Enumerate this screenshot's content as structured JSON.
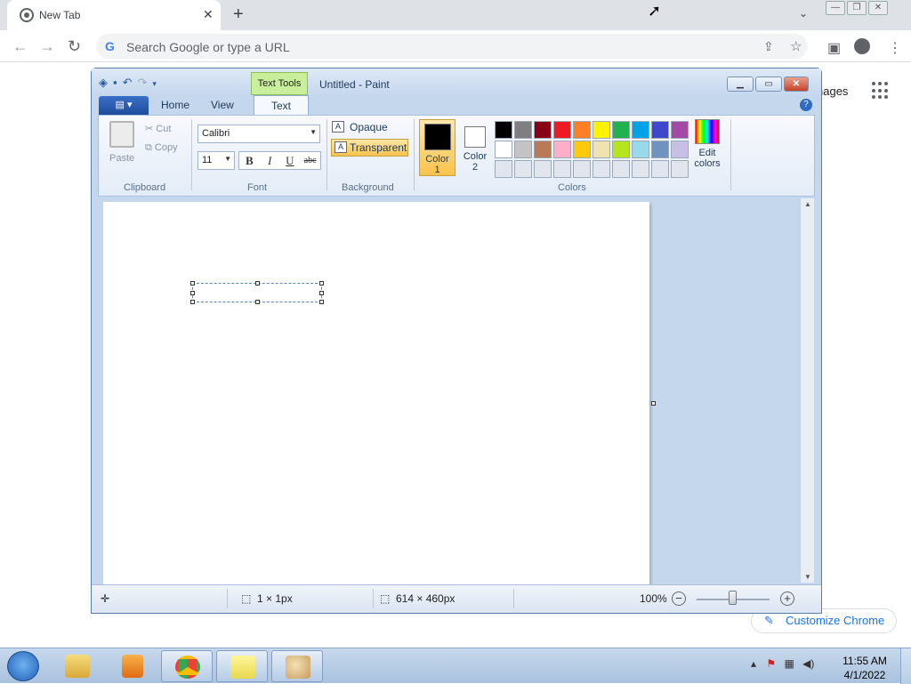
{
  "browser": {
    "tab_title": "New Tab",
    "tab_close": "✕",
    "new_tab": "+",
    "window_controls": [
      "—",
      "❐",
      "✕"
    ],
    "omnibox_placeholder": "Search Google or type a URL",
    "images_link": "nages",
    "customize_label": "Customize Chrome"
  },
  "paint": {
    "context_tab": "Text Tools",
    "title": "Untitled - Paint",
    "ribbon_tabs": [
      "Home",
      "View",
      "Text"
    ],
    "clipboard": {
      "paste": "Paste",
      "cut": "Cut",
      "copy": "Copy",
      "group": "Clipboard"
    },
    "font": {
      "name": "Calibri",
      "size": "11",
      "bold": "B",
      "italic": "I",
      "underline": "U",
      "strike": "abc",
      "group": "Font"
    },
    "background": {
      "opaque": "Opaque",
      "transparent": "Transparent",
      "group": "Background"
    },
    "colors": {
      "color1_label": "Color\n1",
      "color2_label": "Color\n2",
      "edit_label": "Edit\ncolors",
      "group": "Colors",
      "palette": [
        "#000000",
        "#7f7f7f",
        "#880015",
        "#ed1c24",
        "#ff7f27",
        "#fff200",
        "#22b14c",
        "#00a2e8",
        "#3f48cc",
        "#a349a4",
        "#ffffff",
        "#c3c3c3",
        "#b97a57",
        "#ffaec9",
        "#ffc90e",
        "#efe4b0",
        "#b5e61d",
        "#99d9ea",
        "#7092be",
        "#c8bfe7",
        "#e1e6ee",
        "#e1e6ee",
        "#e1e6ee",
        "#e1e6ee",
        "#e1e6ee",
        "#e1e6ee",
        "#e1e6ee",
        "#e1e6ee",
        "#e1e6ee",
        "#e1e6ee"
      ]
    },
    "status": {
      "selection": "1 × 1px",
      "canvas_size": "614 × 460px",
      "zoom": "100%"
    }
  },
  "taskbar": {
    "time": "11:55 AM",
    "date": "4/1/2022"
  }
}
